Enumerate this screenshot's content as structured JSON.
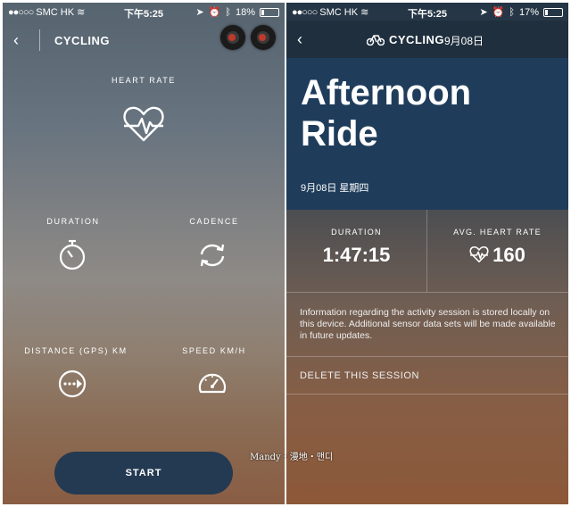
{
  "left": {
    "status": {
      "carrier": "SMC HK",
      "time": "下午5:25",
      "battery": "18%",
      "battery_fraction": 0.18
    },
    "nav": {
      "title": "CYCLING"
    },
    "metrics": {
      "heart_rate": "HEART RATE",
      "duration": "DURATION",
      "cadence": "CADENCE",
      "distance": "DISTANCE (GPS) KM",
      "speed": "SPEED KM/H"
    },
    "start_label": "START"
  },
  "right": {
    "status": {
      "carrier": "SMC HK",
      "time": "下午5:25",
      "battery": "17%",
      "battery_fraction": 0.17
    },
    "nav": {
      "title": "CYCLING",
      "date": "9月08日"
    },
    "title_line1": "Afternoon",
    "title_line2": "Ride",
    "date_full": "9月08日 星期四",
    "stats": {
      "duration_label": "DURATION",
      "duration_value": "1:47:15",
      "hr_label": "AVG. HEART RATE",
      "hr_value": "160"
    },
    "info_text": "Information regarding the activity session is stored locally on this device. Additional sensor data sets will be made available in future updates.",
    "delete_label": "DELETE THIS SESSION"
  },
  "watermark": "Mandy・漫地・맨디"
}
